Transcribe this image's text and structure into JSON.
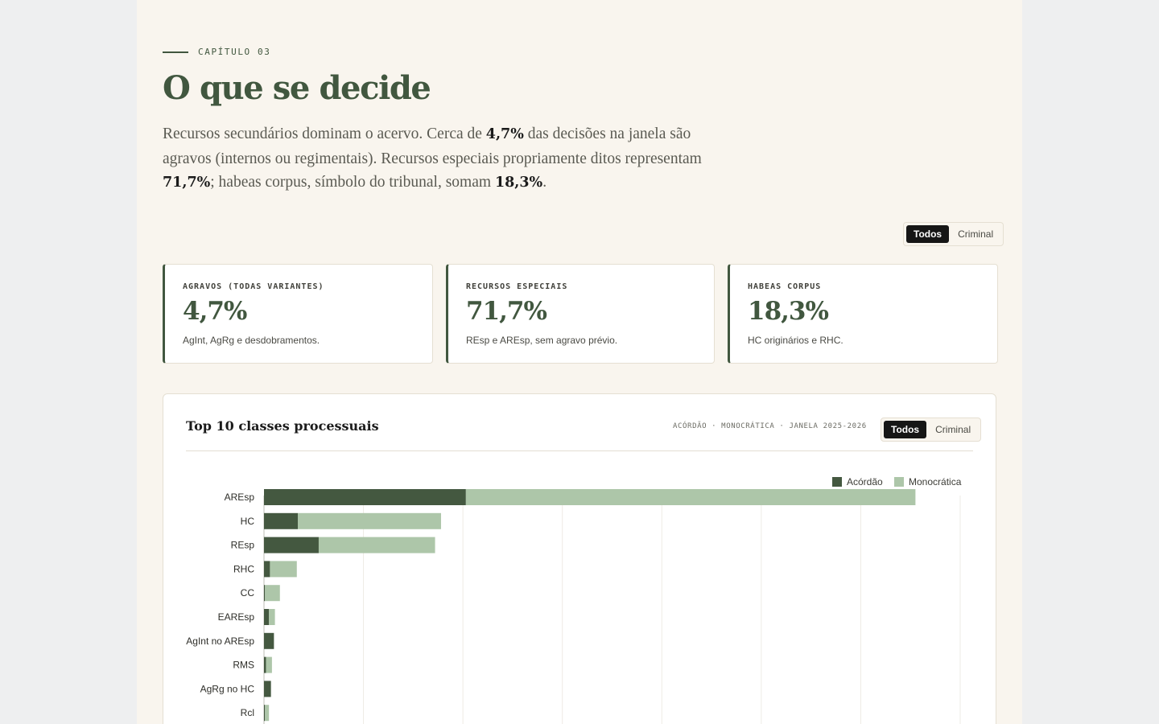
{
  "chapter": {
    "kicker": "CAPÍTULO 03",
    "title": "O que se decide"
  },
  "lead": {
    "t1": "Recursos secundários dominam o acervo. Cerca de ",
    "v1": "4,7%",
    "t2": " das decisões na janela são agravos (internos ou regimentais). Recursos especiais propriamente ditos representam ",
    "v2": "71,7%",
    "t3": "; habeas corpus, símbolo do tribunal, somam ",
    "v3": "18,3%",
    "t4": "."
  },
  "filter": {
    "all": "Todos",
    "criminal": "Criminal",
    "selected": "Todos"
  },
  "cards": [
    {
      "label": "AGRAVOS (TODAS VARIANTES)",
      "value": "4,7%",
      "note": "AgInt, AgRg e desdobramentos."
    },
    {
      "label": "RECURSOS ESPECIAIS",
      "value": "71,7%",
      "note": "REsp e AREsp, sem agravo prévio."
    },
    {
      "label": "HABEAS CORPUS",
      "value": "18,3%",
      "note": "HC originários e RHC."
    }
  ],
  "panel": {
    "title": "Top 10 classes processuais",
    "meta": "ACÓRDÃO · MONOCRÁTICA · JANELA 2025-2026"
  },
  "colors": {
    "accent": "#41573f",
    "acordao": "#445840",
    "monocratica": "#adc6a9",
    "ink": "#1b1b1b"
  },
  "chart_data": {
    "type": "bar",
    "orientation": "horizontal",
    "stacked": true,
    "categories": [
      "AREsp",
      "HC",
      "REsp",
      "RHC",
      "CC",
      "EAREsp",
      "AgInt no AREsp",
      "RMS",
      "AgRg no HC",
      "Rcl"
    ],
    "series": [
      {
        "name": "Acórdão",
        "values": [
          20.3,
          3.4,
          5.5,
          0.6,
          0.1,
          0.5,
          1.0,
          0.2,
          0.7,
          0.1
        ]
      },
      {
        "name": "Monocrática",
        "values": [
          45.2,
          14.4,
          11.7,
          2.7,
          1.5,
          0.6,
          0.0,
          0.6,
          0.0,
          0.4
        ]
      }
    ],
    "xlim": [
      0,
      70
    ],
    "grid": true,
    "legend": "top-right"
  }
}
